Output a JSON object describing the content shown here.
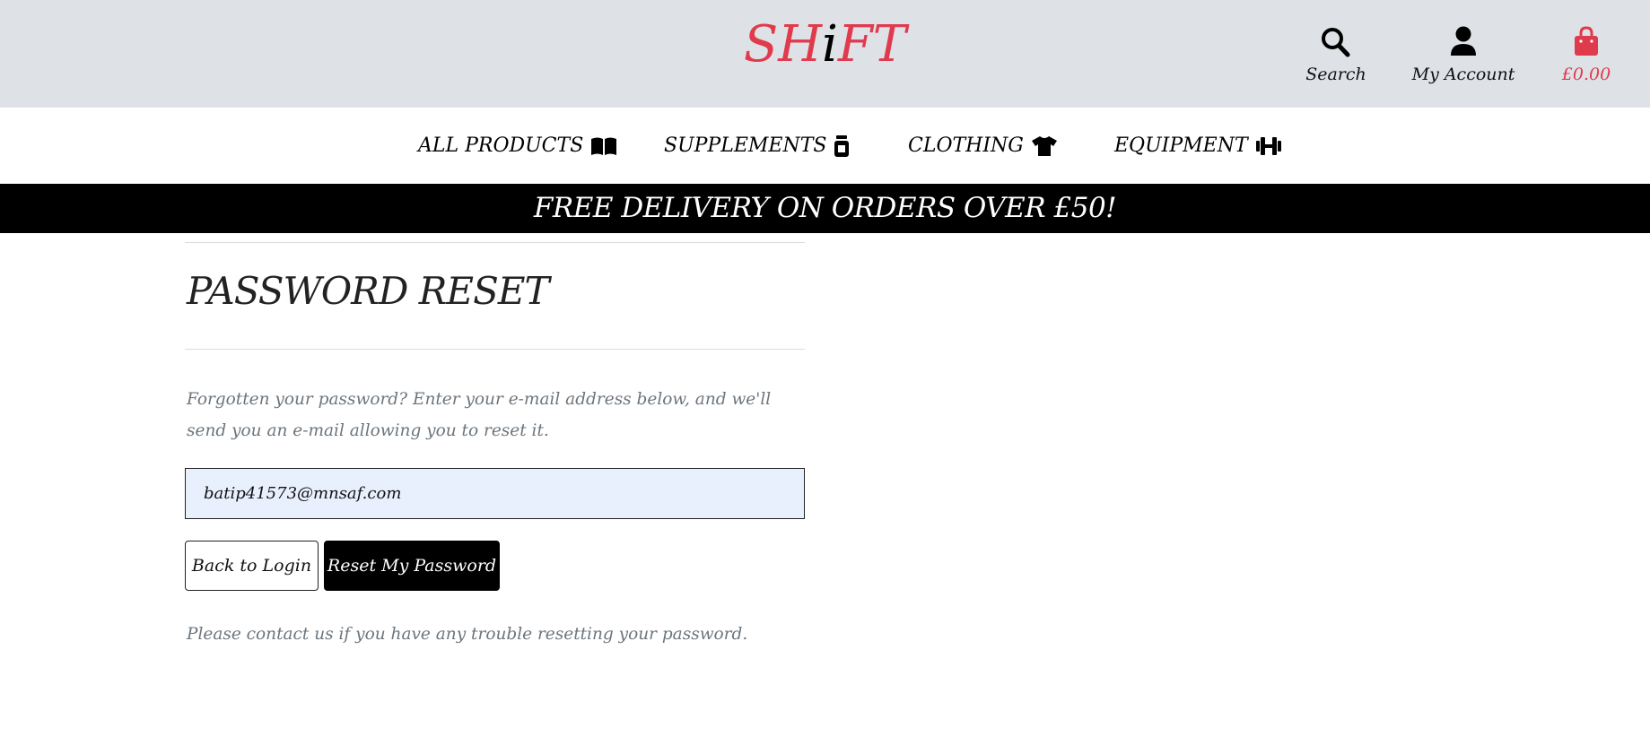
{
  "header": {
    "logo_part1": "SH",
    "logo_part2": "i",
    "logo_part3": "FT",
    "search_label": "Search",
    "account_label": "My Account",
    "cart_total": "£0.00",
    "icons": {
      "search": "search-icon",
      "account": "user-icon",
      "cart": "shopping-bag-icon"
    }
  },
  "nav": {
    "items": [
      {
        "label": "ALL PRODUCTS",
        "icon": "book-open-icon"
      },
      {
        "label": "SUPPLEMENTS",
        "icon": "jar-icon"
      },
      {
        "label": "CLOTHING",
        "icon": "tshirt-icon"
      },
      {
        "label": "EQUIPMENT",
        "icon": "dumbbell-icon"
      }
    ]
  },
  "banner": {
    "text": "FREE DELIVERY ON ORDERS OVER £50!"
  },
  "main": {
    "title": "PASSWORD RESET",
    "intro": "Forgotten your password? Enter your e-mail address below, and we'll send you an e-mail allowing you to reset it.",
    "email_value": "batip41573@mnsaf.com",
    "back_button": "Back to Login",
    "reset_button": "Reset My Password",
    "footnote": "Please contact us if you have any trouble resetting your password."
  },
  "colors": {
    "brand": "#e03a4d",
    "header_bg": "#dee2e6",
    "banner_bg": "#000000",
    "input_bg": "#e8f0fe",
    "muted_text": "#6c757d"
  }
}
